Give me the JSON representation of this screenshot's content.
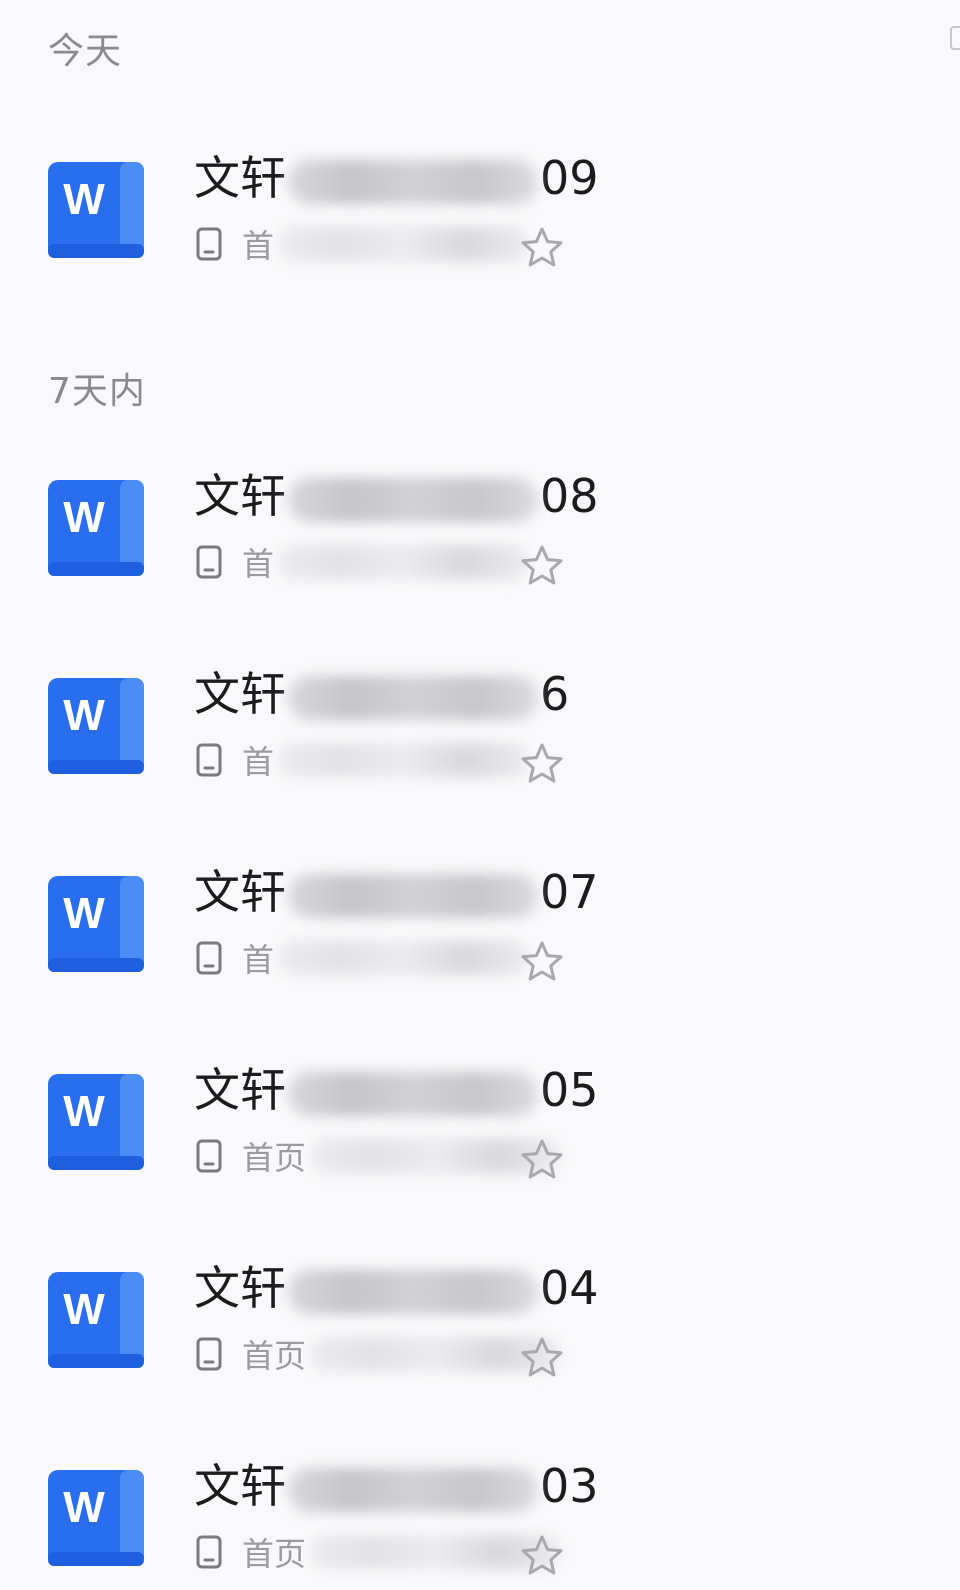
{
  "sections": {
    "today": {
      "label": "今天"
    },
    "week": {
      "label": "7天内"
    }
  },
  "files": [
    {
      "title_prefix": "文轩",
      "title_suffix": "09",
      "location": "首",
      "icon": "word-icon"
    },
    {
      "title_prefix": "文轩",
      "title_suffix": "08",
      "location": "首",
      "icon": "word-icon"
    },
    {
      "title_prefix": "文轩",
      "title_suffix": "6",
      "location": "首",
      "icon": "word-icon"
    },
    {
      "title_prefix": "文轩",
      "title_suffix": "07",
      "location": "首",
      "icon": "word-icon"
    },
    {
      "title_prefix": "文轩",
      "title_suffix": "05",
      "location": "首页",
      "icon": "word-icon"
    },
    {
      "title_prefix": "文轩",
      "title_suffix": "04",
      "location": "首页",
      "icon": "word-icon"
    },
    {
      "title_prefix": "文轩",
      "title_suffix": "03",
      "location": "首页",
      "icon": "word-icon"
    }
  ],
  "icons": {
    "file_type": "word-icon",
    "device": "phone-icon",
    "favorite": "star-icon"
  },
  "colors": {
    "background": "#f9f9fb",
    "word_blue": "#2a6ef0",
    "section_text": "#8a8a8e",
    "meta_text": "#9a9aa0"
  }
}
